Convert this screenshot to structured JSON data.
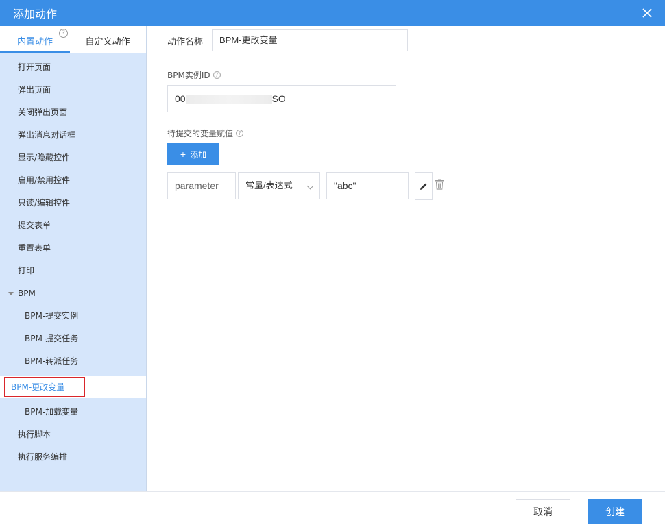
{
  "dialog": {
    "title": "添加动作"
  },
  "tabs": {
    "builtin": "内置动作",
    "custom": "自定义动作",
    "help": "?"
  },
  "actions": {
    "items": [
      "打开页面",
      "弹出页面",
      "关闭弹出页面",
      "弹出消息对话框",
      "显示/隐藏控件",
      "启用/禁用控件",
      "只读/编辑控件",
      "提交表单",
      "重置表单",
      "打印"
    ],
    "bpm_group": "BPM",
    "bpm_items": [
      "BPM-提交实例",
      "BPM-提交任务",
      "BPM-转派任务"
    ],
    "bpm_selected": "BPM-更改变量",
    "bpm_items_after": [
      "BPM-加载变量"
    ],
    "tail_items": [
      "执行脚本",
      "执行服务编排"
    ]
  },
  "form": {
    "name_label": "动作名称",
    "name_value": "BPM-更改变量",
    "instance_label": "BPM实例ID",
    "instance_prefix": "00",
    "instance_suffix": "SO",
    "vars_label": "待提交的变量赋值",
    "add_button": "添加",
    "var_param": "parameter",
    "var_type": "常量/表达式",
    "var_value": "\"abc\""
  },
  "footer": {
    "cancel": "取消",
    "create": "创建"
  },
  "colors": {
    "primary": "#3a8ee6",
    "sidebar": "#d6e6fb",
    "highlight_border": "#d9262b"
  },
  "icons": {
    "close": "close-icon",
    "edit": "pencil-icon",
    "delete": "trash-icon",
    "add": "plus-icon"
  }
}
